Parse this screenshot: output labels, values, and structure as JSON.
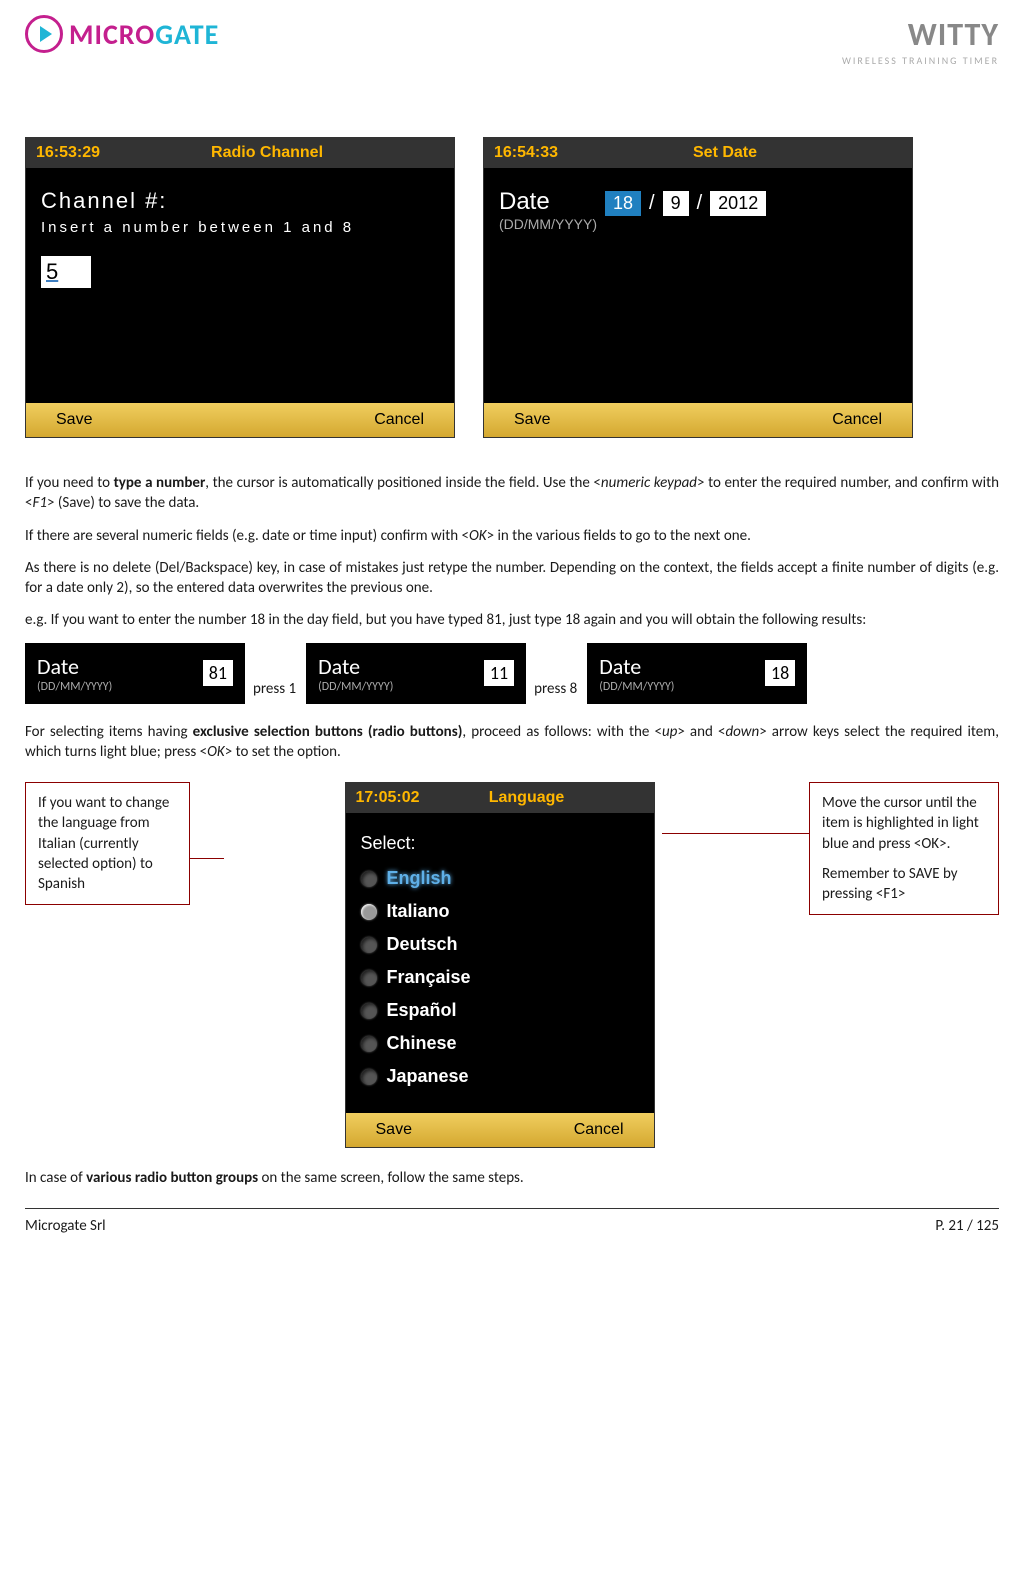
{
  "header": {
    "logo_micro": "MICRO",
    "logo_gate": "GATE",
    "witty": "WITTY",
    "witty_sub": "WIRELESS TRAINING TIMER"
  },
  "screen1": {
    "time": "16:53:29",
    "title": "Radio  Channel",
    "label": "Channel  #:",
    "hint": "Insert  a  number  between  1  and  8",
    "value": "5",
    "btn_save": "Save",
    "btn_cancel": "Cancel"
  },
  "screen2": {
    "time": "16:54:33",
    "title": "Set  Date",
    "label": "Date",
    "fmt": "(DD/MM/YYYY)",
    "day": "18",
    "month": "9",
    "year": "2012",
    "btn_save": "Save",
    "btn_cancel": "Cancel"
  },
  "paragraphs": {
    "p1a": "If you need to ",
    "p1b": "type a number",
    "p1c": ", the cursor is automatically positioned inside the field. Use the <",
    "p1d": "numeric keypad",
    "p1e": "> to enter the required number, and confirm with <",
    "p1f": "F1",
    "p1g": "> (Save) to save the data.",
    "p2": "If there are several numeric fields (e.g. date or time input) confirm with <",
    "p2b": "OK",
    "p2c": "> in the various fields to go to the next one.",
    "p3": "As there is no delete (Del/Backspace) key, in case of mistakes just retype the number. Depending on the context, the fields accept a finite number of digits (e.g. for a date only 2), so the entered data overwrites the previous one.",
    "p4": "e.g. If you want to enter the number 18 in the day field, but you have typed 81, just type 18 again and you will obtain the following results:",
    "p5a": "For selecting items having ",
    "p5b": "exclusive selection buttons (radio buttons)",
    "p5c": ", proceed as follows: with the <",
    "p5d": "up",
    "p5e": "> and <",
    "p5f": "down",
    "p5g": "> arrow keys select the required item, which turns light blue; press <",
    "p5h": "OK",
    "p5i": "> to set the option.",
    "p6a": "In case of ",
    "p6b": "various radio button groups",
    "p6c": " on the same screen, follow the same steps."
  },
  "seq": {
    "label": "Date",
    "fmt": "(DD/MM/YYYY)",
    "v1": "81",
    "t1": "press 1",
    "v2": "11",
    "t2": "press 8",
    "v3": "18"
  },
  "callouts": {
    "left": "If you want to change the language from Italian (currently selected option) to Spanish",
    "right1": "Move the cursor until the item is highlighted in light blue and press <OK>.",
    "right2": "Remember to SAVE by pressing <F1>"
  },
  "screen3": {
    "time": "17:05:02",
    "title": "Language",
    "select": "Select:",
    "items": [
      "English",
      "Italiano",
      "Deutsch",
      "Française",
      "Español",
      "Chinese",
      "Japanese"
    ],
    "btn_save": "Save",
    "btn_cancel": "Cancel"
  },
  "footer": {
    "left": "Microgate Srl",
    "right": "P. 21 / 125"
  }
}
